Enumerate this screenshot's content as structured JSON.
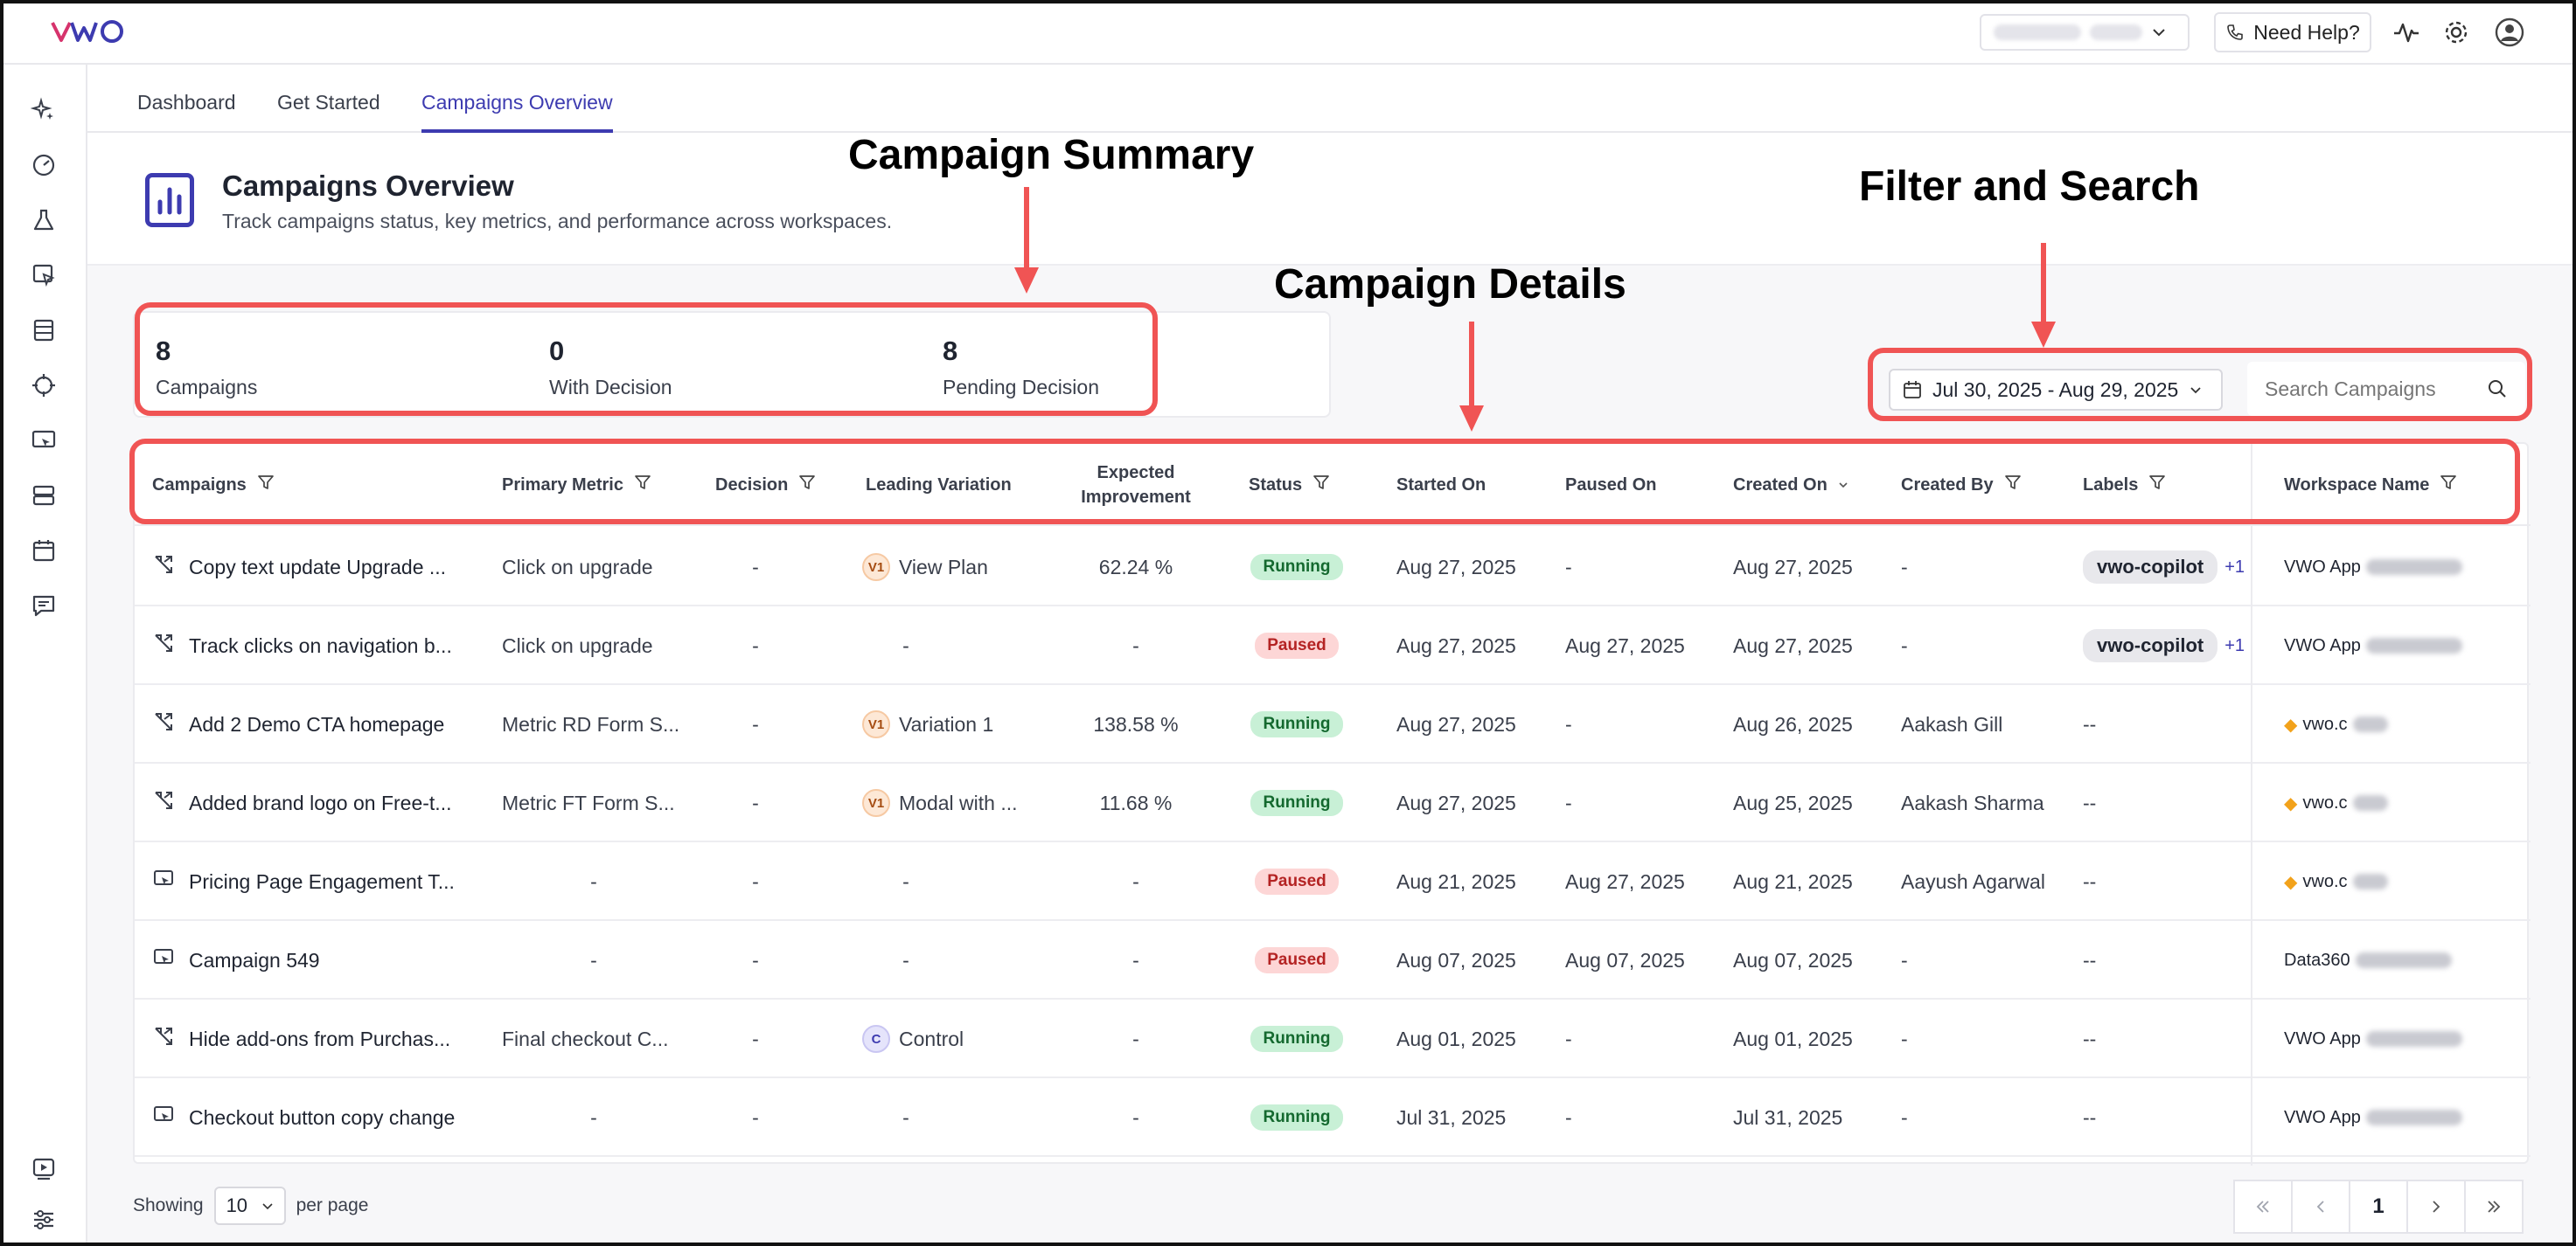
{
  "app": {
    "logo_text": "VWO",
    "account_name": "vwo.com",
    "help_label": "Need Help?"
  },
  "nav": {
    "tabs": [
      {
        "label": "Dashboard"
      },
      {
        "label": "Get Started"
      },
      {
        "label": "Campaigns Overview",
        "active": true
      }
    ]
  },
  "header": {
    "title": "Campaigns Overview",
    "subtitle": "Track campaigns status, key metrics, and performance across workspaces."
  },
  "summary": {
    "campaigns": {
      "value": "8",
      "label": "Campaigns"
    },
    "with_decision": {
      "value": "0",
      "label": "With Decision"
    },
    "pending_decision": {
      "value": "8",
      "label": "Pending Decision"
    }
  },
  "filters": {
    "date_range": "Jul 30, 2025 - Aug 29, 2025",
    "search_placeholder": "Search Campaigns"
  },
  "table": {
    "headers": {
      "campaigns": "Campaigns",
      "primary_metric": "Primary Metric",
      "decision": "Decision",
      "leading_variation": "Leading Variation",
      "expected_improvement_1": "Expected",
      "expected_improvement_2": "Improvement",
      "status": "Status",
      "started_on": "Started On",
      "paused_on": "Paused On",
      "created_on": "Created On",
      "created_by": "Created By",
      "labels": "Labels",
      "workspace_name": "Workspace Name"
    },
    "rows": [
      {
        "name": "Copy text update Upgrade ...",
        "type": "split",
        "metric": "Click on upgrade",
        "decision": "-",
        "var_tag": "V1",
        "variation": "View Plan",
        "improvement": "62.24 %",
        "status": "Running",
        "started": "Aug 27, 2025",
        "paused": "-",
        "created": "Aug 27, 2025",
        "created_by": "-",
        "label": "vwo-copilot",
        "label_more": "+1",
        "workspace": "VWO App"
      },
      {
        "name": "Track clicks on navigation b...",
        "type": "split",
        "metric": "Click on upgrade",
        "decision": "-",
        "var_tag": "",
        "variation": "-",
        "improvement": "-",
        "status": "Paused",
        "started": "Aug 27, 2025",
        "paused": "Aug 27, 2025",
        "created": "Aug 27, 2025",
        "created_by": "-",
        "label": "vwo-copilot",
        "label_more": "+1",
        "workspace": "VWO App"
      },
      {
        "name": "Add 2 Demo CTA homepage",
        "type": "split",
        "metric": "Metric RD Form S...",
        "decision": "-",
        "var_tag": "V1",
        "variation": "Variation 1",
        "improvement": "138.58 %",
        "status": "Running",
        "started": "Aug 27, 2025",
        "paused": "-",
        "created": "Aug 26, 2025",
        "created_by": "Aakash Gill",
        "label": "--",
        "label_more": "",
        "workspace": "vwo.c"
      },
      {
        "name": "Added brand logo on Free-t...",
        "type": "split",
        "metric": "Metric FT Form S...",
        "decision": "-",
        "var_tag": "V1",
        "variation": "Modal with ...",
        "improvement": "11.68 %",
        "status": "Running",
        "started": "Aug 27, 2025",
        "paused": "-",
        "created": "Aug 25, 2025",
        "created_by": "Aakash Sharma",
        "label": "--",
        "label_more": "",
        "workspace": "vwo.c"
      },
      {
        "name": "Pricing Page Engagement T...",
        "type": "insights",
        "metric": "-",
        "decision": "-",
        "var_tag": "",
        "variation": "-",
        "improvement": "-",
        "status": "Paused",
        "started": "Aug 21, 2025",
        "paused": "Aug 27, 2025",
        "created": "Aug 21, 2025",
        "created_by": "Aayush Agarwal",
        "label": "--",
        "label_more": "",
        "workspace": "vwo.c"
      },
      {
        "name": "Campaign 549",
        "type": "insights",
        "metric": "-",
        "decision": "-",
        "var_tag": "",
        "variation": "-",
        "improvement": "-",
        "status": "Paused",
        "started": "Aug 07, 2025",
        "paused": "Aug 07, 2025",
        "created": "Aug 07, 2025",
        "created_by": "-",
        "label": "--",
        "label_more": "",
        "workspace": "Data360"
      },
      {
        "name": "Hide add-ons from Purchas...",
        "type": "split",
        "metric": "Final checkout C...",
        "decision": "-",
        "var_tag": "C",
        "variation": "Control",
        "improvement": "-",
        "status": "Running",
        "started": "Aug 01, 2025",
        "paused": "-",
        "created": "Aug 01, 2025",
        "created_by": "-",
        "label": "--",
        "label_more": "",
        "workspace": "VWO App"
      },
      {
        "name": "Checkout button copy change",
        "type": "insights",
        "metric": "-",
        "decision": "-",
        "var_tag": "",
        "variation": "-",
        "improvement": "-",
        "status": "Running",
        "started": "Jul 31, 2025",
        "paused": "-",
        "created": "Jul 31, 2025",
        "created_by": "-",
        "label": "--",
        "label_more": "",
        "workspace": "VWO App"
      }
    ]
  },
  "footer": {
    "showing": "Showing",
    "per_page_value": "10",
    "per_page_label": "per page",
    "current_page": "1"
  },
  "annotations": {
    "campaign_summary": "Campaign Summary",
    "campaign_details": "Campaign Details",
    "filter_and_search": "Filter and Search",
    "color": "#f05454"
  },
  "colors": {
    "brand": "#3d3bb0",
    "running_bg": "#c8f0d6",
    "paused_bg": "#fdd6d6"
  }
}
